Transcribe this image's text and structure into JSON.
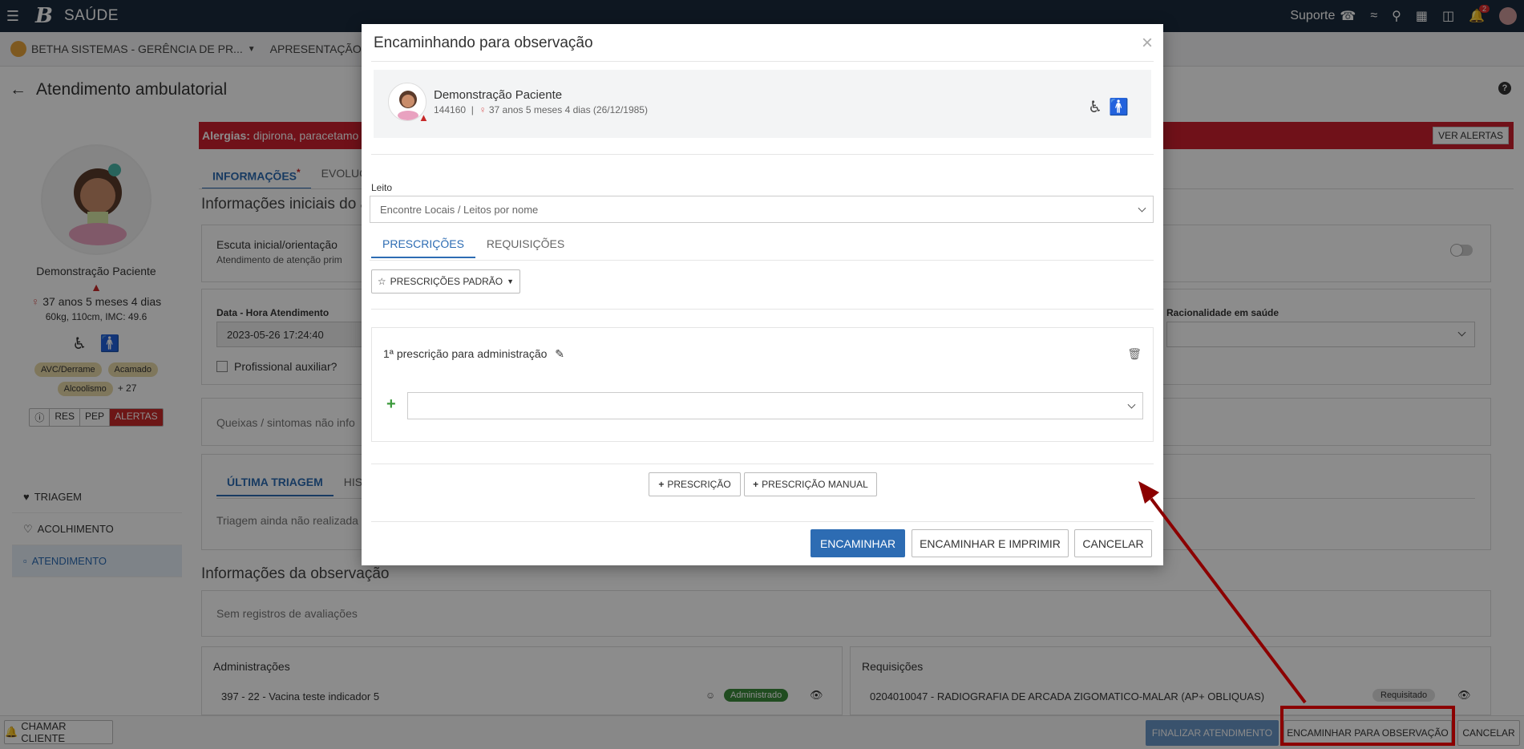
{
  "topbar": {
    "logo": "B",
    "app_name": "SAÚDE",
    "support_label": "Suporte",
    "notif_count": "2"
  },
  "orgbar": {
    "org": "BETHA SISTEMAS - GERÊNCIA DE PR...",
    "unit": "APRESENTAÇÃO - CEN"
  },
  "page": {
    "title": "Atendimento ambulatorial"
  },
  "profile": {
    "name": "Demonstração Paciente",
    "age": "37 anos 5 meses 4 dias",
    "measures": "60kg, 110cm, IMC: 49.6",
    "chips": [
      "AVC/Derrame",
      "Acamado",
      "Alcoolismo"
    ],
    "more": "+ 27",
    "segments": [
      "ⓘ",
      "RES",
      "PEP",
      "ALERTAS"
    ]
  },
  "sidenav": [
    {
      "label": "TRIAGEM"
    },
    {
      "label": "ACOLHIMENTO"
    },
    {
      "label": "ATENDIMENTO"
    }
  ],
  "alert": {
    "label": "Alergias:",
    "text": "dipirona, paracetamo",
    "button": "VER ALERTAS"
  },
  "main_tabs": [
    "INFORMAÇÕES",
    "EVOLUÇ"
  ],
  "main": {
    "section1_title": "Informações iniciais do a",
    "escuta_title": "Escuta inicial/orientação",
    "escuta_sub": "Atendimento de atenção prim",
    "data_label": "Data - Hora Atendimento",
    "data_value": "2023-05-26 17:24:40",
    "prof_aux": "Profissional auxiliar?",
    "racionalidade": "Racionalidade em saúde",
    "queixas": "Queixas / sintomas não info",
    "triagem_tab1": "ÚLTIMA TRIAGEM",
    "triagem_tab2": "HIS",
    "triagem_empty": "Triagem ainda não realizada",
    "section2_title": "Informações da observação",
    "sem_registros": "Sem registros de avaliações",
    "adm_title": "Administrações",
    "adm_item": "397 - 22 - Vacina teste indicador 5",
    "adm_badge": "Administrado",
    "req_title": "Requisições",
    "req_item": "0204010047 - RADIOGRAFIA DE ARCADA ZIGOMATICO-MALAR (AP+ OBLIQUAS)",
    "req_badge": "Requisitado"
  },
  "bottom": {
    "chamar": "CHAMAR CLIENTE",
    "finalizar": "FINALIZAR ATENDIMENTO",
    "encaminhar_obs": "ENCAMINHAR PARA OBSERVAÇÃO",
    "cancelar": "CANCELAR"
  },
  "modal": {
    "title": "Encaminhando para observação",
    "patient_name": "Demonstração Paciente",
    "patient_id": "144160",
    "patient_age": "37 anos 5 meses 4 dias (26/12/1985)",
    "leito_label": "Leito",
    "leito_placeholder": "Encontre Locais / Leitos por nome",
    "tabs": [
      "PRESCRIÇÕES",
      "REQUISIÇÕES"
    ],
    "presc_padrao": "PRESCRIÇÕES PADRÃO",
    "presc_title": "1ª prescrição para administração",
    "add_presc": "PRESCRIÇÃO",
    "add_presc_manual": "PRESCRIÇÃO MANUAL",
    "btn_encaminhar": "ENCAMINHAR",
    "btn_encaminhar_imprimir": "ENCAMINHAR E IMPRIMIR",
    "btn_cancelar": "CANCELAR"
  },
  "colors": {
    "primary": "#2d6cb3",
    "alert": "#cc1f2f",
    "annotation": "#8b0000",
    "topbar": "#1b2a3c"
  }
}
